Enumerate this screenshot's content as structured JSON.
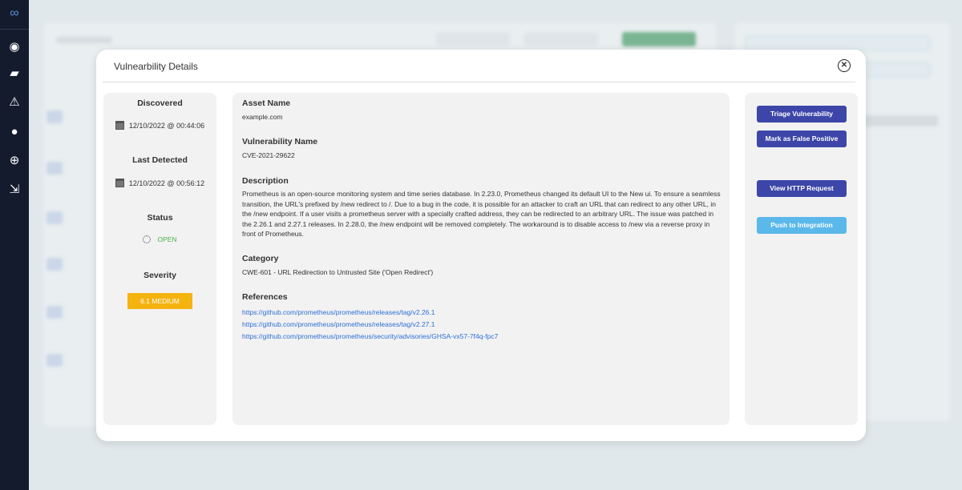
{
  "sidebar": {
    "icons": [
      "logo-icon",
      "globe-icon",
      "folder-alert-icon",
      "warning-icon",
      "user-icon",
      "crosshair-icon",
      "export-icon"
    ]
  },
  "modal": {
    "title": "Vulnearbility Details",
    "left": {
      "discovered_label": "Discovered",
      "discovered": "12/10/2022 @ 00:44:06",
      "last_detected_label": "Last Detected",
      "last_detected": "12/10/2022 @ 00:56:12",
      "status_label": "Status",
      "status": "OPEN",
      "severity_label": "Severity",
      "severity": "6.1 MEDIUM",
      "severity_color": "#f5b30f",
      "status_color": "#4caf50"
    },
    "main": {
      "asset_label": "Asset Name",
      "asset": "example.com",
      "vuln_label": "Vulnerability Name",
      "vuln": "CVE-2021-29622",
      "desc_label": "Description",
      "desc": "Prometheus is an open-source monitoring system and time series database. In 2.23.0, Prometheus changed its default UI to the New ui. To ensure a seamless transition, the URL's prefixed by /new redirect to /. Due to a bug in the code, it is possible for an attacker to craft an URL that can redirect to any other URL, in the /new endpoint. If a user visits a prometheus server with a specially crafted address, they can be redirected to an arbitrary URL. The issue was patched in the 2.26.1 and 2.27.1 releases. In 2.28.0, the /new endpoint will be removed completely. The workaround is to disable access to /new via a reverse proxy in front of Prometheus.",
      "category_label": "Category",
      "category": "CWE-601 - URL Redirection to Untrusted Site ('Open Redirect')",
      "references_label": "References",
      "references": [
        "https://github.com/prometheus/prometheus/releases/tag/v2.26.1",
        "https://github.com/prometheus/prometheus/releases/tag/v2.27.1",
        "https://github.com/prometheus/prometheus/security/advisories/GHSA-vx57-7f4q-fpc7"
      ]
    },
    "actions": {
      "triage": "Triage Vulnerability",
      "false_positive": "Mark as False Positive",
      "view_http": "View HTTP Request",
      "push": "Push to Integration"
    }
  }
}
